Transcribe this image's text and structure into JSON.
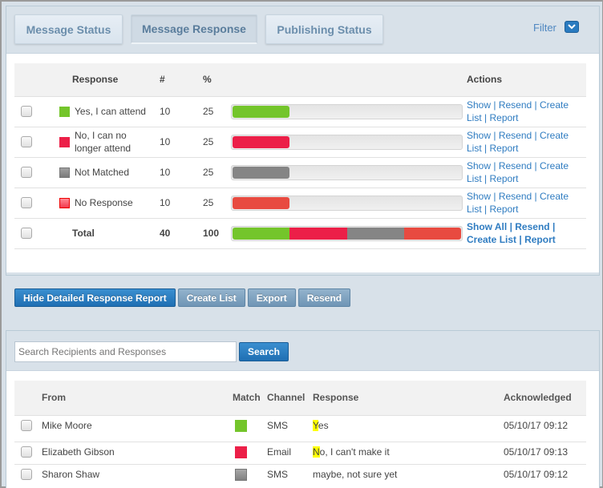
{
  "tabs": [
    {
      "label": "Message Status",
      "active": false
    },
    {
      "label": "Message Response",
      "active": true
    },
    {
      "label": "Publishing Status",
      "active": false
    }
  ],
  "filter": {
    "label": "Filter",
    "icon": "chevron-down-icon"
  },
  "colors": {
    "yes": "#74c52b",
    "no": "#ec1f48",
    "not_matched": "#858585",
    "no_response": "#e84a40",
    "link": "#2f7cc1",
    "primary_button": "#2a7bc0",
    "highlight": "#ffff00"
  },
  "summary": {
    "headers": {
      "response": "Response",
      "count": "#",
      "percent": "%",
      "actions": "Actions"
    },
    "rows": [
      {
        "key": "yes",
        "response": "Yes, I can attend",
        "count": "10",
        "percent": 25,
        "percent_label": "25"
      },
      {
        "key": "no",
        "response": "No, I can no longer attend",
        "count": "10",
        "percent": 25,
        "percent_label": "25"
      },
      {
        "key": "not_matched",
        "response": "Not Matched",
        "count": "10",
        "percent": 25,
        "percent_label": "25"
      },
      {
        "key": "no_response",
        "response": "No Response",
        "count": "10",
        "percent": 25,
        "percent_label": "25"
      }
    ],
    "row_actions": [
      "Show",
      "Resend",
      "Create List",
      "Report"
    ],
    "total": {
      "label": "Total",
      "count": "40",
      "percent": "100",
      "actions": [
        "Show All",
        "Resend",
        "Create List",
        "Report"
      ]
    }
  },
  "buttons": {
    "hide_report": "Hide Detailed Response Report",
    "create_list": "Create List",
    "export": "Export",
    "resend": "Resend"
  },
  "search": {
    "placeholder": "Search Recipients and Responses",
    "value": "",
    "button": "Search"
  },
  "recipients": {
    "headers": {
      "from": "From",
      "match": "Match",
      "channel": "Channel",
      "response": "Response",
      "acknowledged": "Acknowledged"
    },
    "rows": [
      {
        "from": "Mike Moore",
        "match": "yes",
        "channel": "SMS",
        "response_highlight": "Y",
        "response_rest": "es",
        "acknowledged": "05/10/17 09:12"
      },
      {
        "from": "Elizabeth Gibson",
        "match": "no",
        "channel": "Email",
        "response_highlight": "N",
        "response_rest": "o, I can't make it",
        "acknowledged": "05/10/17 09:13"
      },
      {
        "from": "Sharon Shaw",
        "match": "not_matched",
        "channel": "SMS",
        "response_highlight": "",
        "response_rest": "maybe, not sure yet",
        "acknowledged": "05/10/17 09:12"
      }
    ]
  }
}
